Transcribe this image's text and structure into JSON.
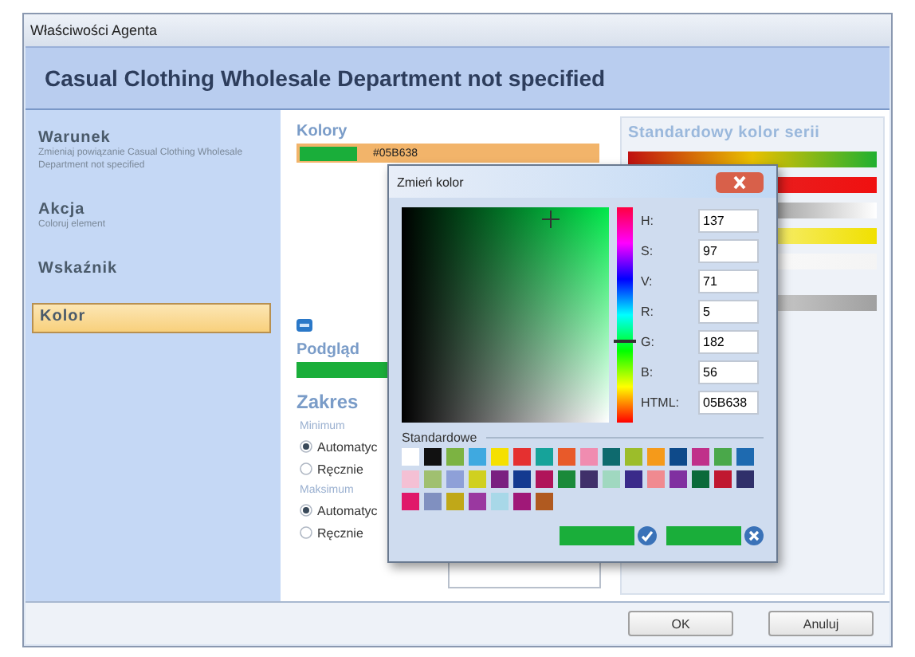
{
  "window": {
    "title": "Właściwości Agenta"
  },
  "header": {
    "title": "Casual Clothing Wholesale Department not specified"
  },
  "sidebar": {
    "items": [
      {
        "label": "Warunek",
        "description": "Zmieniaj powiązanie Casual Clothing Wholesale Department not specified",
        "selected": false
      },
      {
        "label": "Akcja",
        "description": "Coloruj element",
        "selected": false
      },
      {
        "label": "Wskaźnik",
        "selected": false
      },
      {
        "label": "Kolor",
        "selected": true
      }
    ]
  },
  "colors": {
    "title": "Kolory",
    "value": "#05B638"
  },
  "preview": {
    "title": "Podgląd"
  },
  "range": {
    "title": "Zakres",
    "groups": [
      {
        "label": "Minimum",
        "options": [
          {
            "label": "Automatyc",
            "selected": true
          },
          {
            "label": "Ręcznie",
            "selected": false
          }
        ]
      },
      {
        "label": "Maksimum",
        "options": [
          {
            "label": "Automatyc",
            "selected": true
          },
          {
            "label": "Ręcznie",
            "selected": false
          }
        ]
      }
    ]
  },
  "standard_panel": {
    "title": "Standardowy kolor serii"
  },
  "dialog": {
    "title": "Zmień kolor",
    "hue_slider": {
      "level": 0.38
    },
    "fields": [
      {
        "label": "H:",
        "value": "137"
      },
      {
        "label": "S:",
        "value": "97"
      },
      {
        "label": "V:",
        "value": "71"
      },
      {
        "label": "R:",
        "value": "5"
      },
      {
        "label": "G:",
        "value": "182"
      },
      {
        "label": "B:",
        "value": "56"
      },
      {
        "label": "HTML:",
        "value": "05B638"
      }
    ],
    "swatches_label": "Standardowe",
    "swatches": [
      {
        "color": "#ffffff"
      },
      {
        "color": "#111111"
      },
      {
        "color": "#7cb342"
      },
      {
        "color": "#3fa9e0"
      },
      {
        "color": "#f5e000"
      },
      {
        "color": "#e53030"
      },
      {
        "color": "#16a39a"
      },
      {
        "color": "#e85a2a"
      },
      {
        "color": "#f08cb0"
      },
      {
        "color": "#0e6a6e"
      },
      {
        "color": "#9cbd2a"
      },
      {
        "color": "#f59a1a"
      },
      {
        "color": "#0e4a8a"
      },
      {
        "color": "#c0308a"
      },
      {
        "color": "#4aa84a"
      },
      {
        "color": "#1e6ab0"
      },
      {
        "color": "#f4c0d4"
      },
      {
        "color": "#a0c070"
      },
      {
        "color": "#8ea0d8"
      },
      {
        "color": "#d0d020"
      },
      {
        "color": "#7a2080"
      },
      {
        "color": "#143a90"
      },
      {
        "color": "#b0145a"
      },
      {
        "color": "#1a8a3a"
      },
      {
        "color": "#40306a"
      },
      {
        "color": "#a0d8c0"
      },
      {
        "color": "#3a2a8a"
      },
      {
        "color": "#f08a90"
      },
      {
        "color": "#8030a0"
      },
      {
        "color": "#0a6a3a"
      },
      {
        "color": "#c01830"
      },
      {
        "color": "#30306a"
      },
      {
        "color": "#e0186a"
      },
      {
        "color": "#8090c0"
      },
      {
        "color": "#c0a818"
      },
      {
        "color": "#9a38a0"
      },
      {
        "color": "#a8d8e8"
      },
      {
        "color": "#a01878"
      },
      {
        "color": "#b05a20"
      }
    ]
  },
  "buttons": [
    {
      "label": "OK"
    },
    {
      "label": "Anuluj"
    }
  ]
}
